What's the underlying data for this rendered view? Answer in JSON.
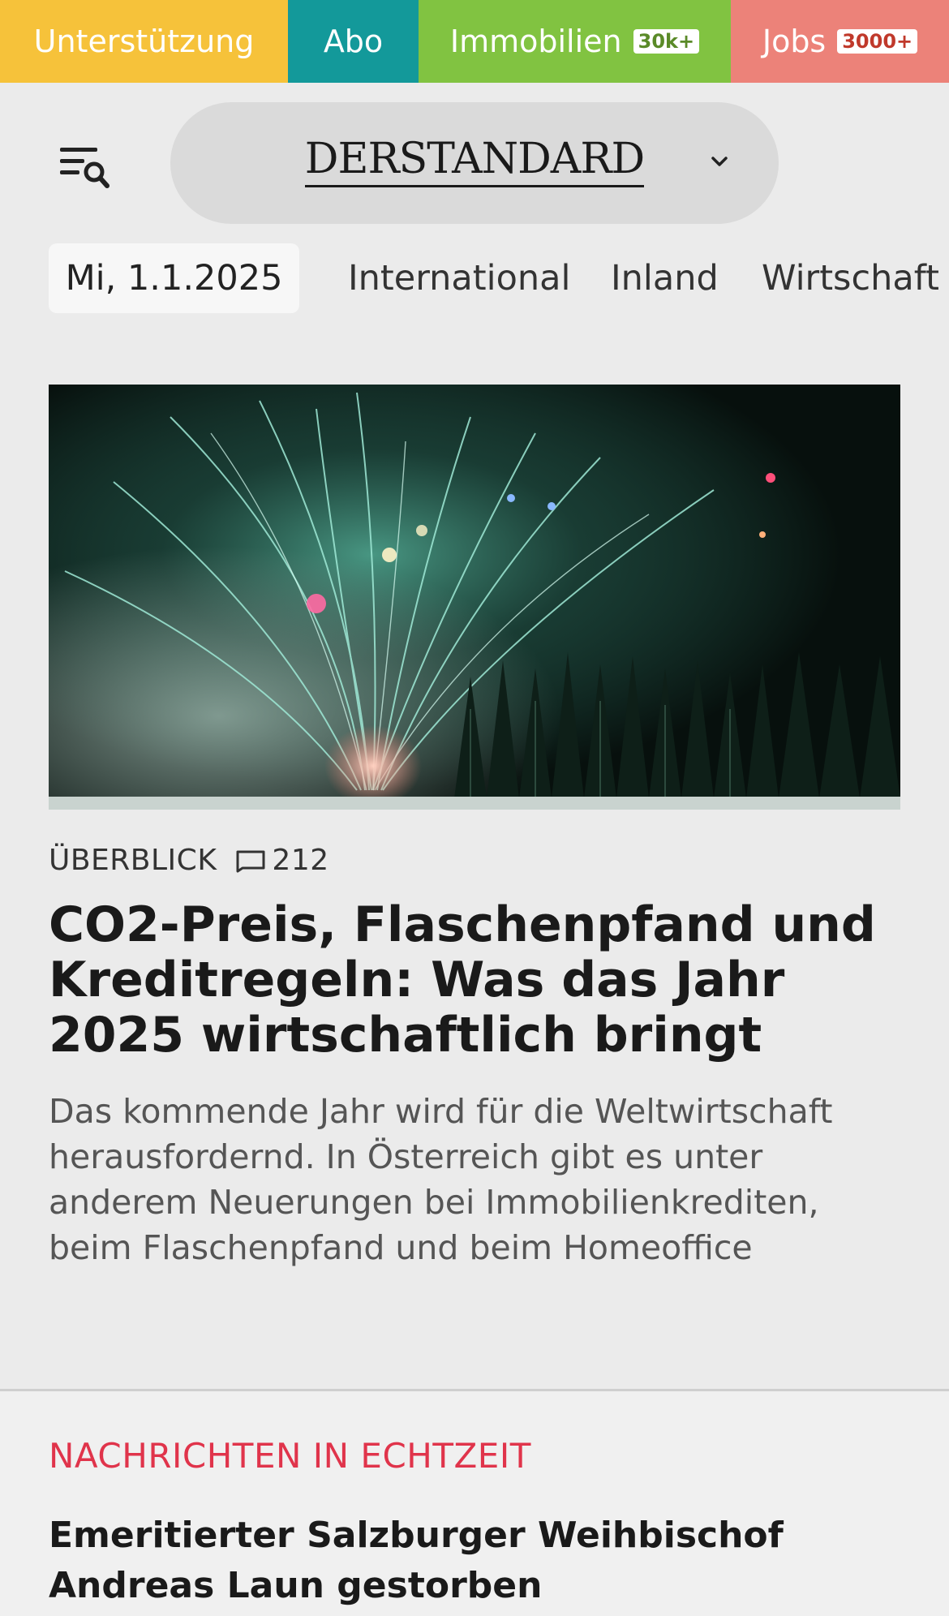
{
  "topbar": {
    "support": "Unterstützung",
    "abo": "Abo",
    "immobilien": "Immobilien",
    "immobilien_badge": "30k+",
    "jobs": "Jobs",
    "jobs_badge": "3000+",
    "colors": {
      "support": "#f6c23a",
      "abo": "#13999a",
      "immobilien": "#81c341",
      "jobs": "#ec8279"
    }
  },
  "header": {
    "logo": "DERSTANDARD",
    "menu_icon": "menu-search-icon",
    "dropdown_icon": "chevron-down-icon"
  },
  "nav": {
    "date": "Mi, 1.1.2025",
    "items": [
      "International",
      "Inland",
      "Wirtschaft"
    ]
  },
  "article": {
    "image_alt": "Feuerwerk über einem Wald bei Nacht",
    "kicker": "ÜBERBLICK",
    "comment_count": "212",
    "headline": "CO2-Preis, Flaschenpfand und Kreditregeln: Was das Jahr 2025 wirtschaftlich bringt",
    "teaser": "Das kommende Jahr wird für die Weltwirtschaft her­ausfordernd. In Österreich gibt es unter anderem Neuerungen bei Immobilienkrediten, beim Flaschenpfand und beim Homeoffice"
  },
  "live": {
    "title": "NACHRICHTEN IN ECHTZEIT",
    "title_color": "#e0344b",
    "first_item": "Emeritierter Salzburger Weihbischof Andreas Laun gestorben"
  }
}
